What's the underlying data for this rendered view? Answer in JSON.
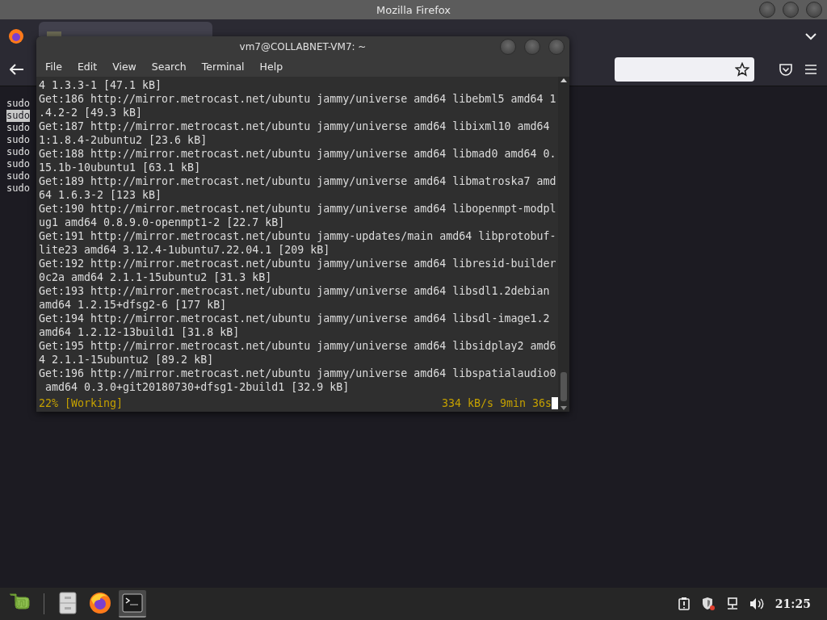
{
  "browser": {
    "title": "Mozilla Firefox",
    "page_lines": [
      {
        "text": "sudo",
        "selected": false
      },
      {
        "text": "sudo",
        "selected": true
      },
      {
        "text": "sudo",
        "selected": false
      },
      {
        "text": "sudo",
        "selected": false
      },
      {
        "text": "sudo",
        "selected": false
      },
      {
        "text": "sudo",
        "selected": false
      },
      {
        "text": "sudo",
        "selected": false
      },
      {
        "text": "sudo",
        "selected": false
      }
    ]
  },
  "terminal": {
    "title": "vm7@COLLABNET-VM7: ~",
    "menu": [
      "File",
      "Edit",
      "View",
      "Search",
      "Terminal",
      "Help"
    ],
    "lines": [
      "4 1.3.3-1 [47.1 kB]",
      "Get:186 http://mirror.metrocast.net/ubuntu jammy/universe amd64 libebml5 amd64 1",
      ".4.2-2 [49.3 kB]",
      "Get:187 http://mirror.metrocast.net/ubuntu jammy/universe amd64 libixml10 amd64",
      "1:1.8.4-2ubuntu2 [23.6 kB]",
      "Get:188 http://mirror.metrocast.net/ubuntu jammy/universe amd64 libmad0 amd64 0.",
      "15.1b-10ubuntu1 [63.1 kB]",
      "Get:189 http://mirror.metrocast.net/ubuntu jammy/universe amd64 libmatroska7 amd",
      "64 1.6.3-2 [123 kB]",
      "Get:190 http://mirror.metrocast.net/ubuntu jammy/universe amd64 libopenmpt-modpl",
      "ug1 amd64 0.8.9.0-openmpt1-2 [22.7 kB]",
      "Get:191 http://mirror.metrocast.net/ubuntu jammy-updates/main amd64 libprotobuf-",
      "lite23 amd64 3.12.4-1ubuntu7.22.04.1 [209 kB]",
      "Get:192 http://mirror.metrocast.net/ubuntu jammy/universe amd64 libresid-builder",
      "0c2a amd64 2.1.1-15ubuntu2 [31.3 kB]",
      "Get:193 http://mirror.metrocast.net/ubuntu jammy/universe amd64 libsdl1.2debian",
      "amd64 1.2.15+dfsg2-6 [177 kB]",
      "Get:194 http://mirror.metrocast.net/ubuntu jammy/universe amd64 libsdl-image1.2",
      "amd64 1.2.12-13build1 [31.8 kB]",
      "Get:195 http://mirror.metrocast.net/ubuntu jammy/universe amd64 libsidplay2 amd6",
      "4 2.1.1-15ubuntu2 [89.2 kB]",
      "Get:196 http://mirror.metrocast.net/ubuntu jammy/universe amd64 libspatialaudio0",
      " amd64 0.3.0+git20180730+dfsg1-2build1 [32.9 kB]"
    ],
    "status": {
      "progress": "22% [Working]",
      "speed": "334 kB/s 9min 36s"
    }
  },
  "taskbar": {
    "launchers": [
      {
        "kind": "menu",
        "selected": false
      },
      {
        "kind": "files",
        "selected": false
      },
      {
        "kind": "firefox",
        "selected": false
      },
      {
        "kind": "terminal",
        "selected": true
      }
    ],
    "clock": "21:25"
  }
}
